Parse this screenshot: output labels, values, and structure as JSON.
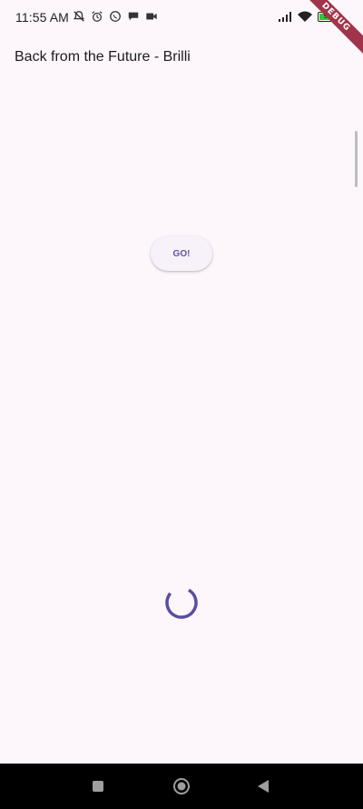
{
  "status_bar": {
    "time": "11:55 AM",
    "left_icons": [
      "bell-off-icon",
      "alarm-icon",
      "whatsapp-icon",
      "chat-icon",
      "video-icon"
    ],
    "right_icons": [
      "signal-icon",
      "wifi-icon",
      "battery-icon"
    ],
    "battery_level": "99"
  },
  "debug_banner": "DEBUG",
  "app_bar": {
    "title": "Back from the Future - Brilli"
  },
  "main": {
    "go_button_label": "GO!",
    "loading_indicator": "circular-progress"
  },
  "colors": {
    "background": "#fdf7fb",
    "accent": "#6750a4",
    "spinner": "#5b4ca3",
    "debug_banner": "#a0344a"
  },
  "nav_bar": {
    "buttons": [
      "recent-apps-icon",
      "home-icon",
      "back-icon"
    ]
  }
}
